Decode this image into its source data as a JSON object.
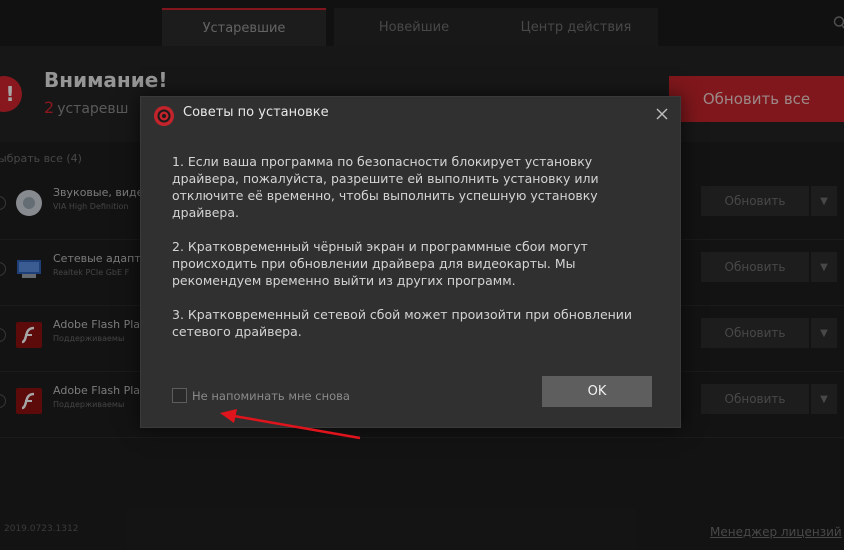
{
  "tabs": [
    {
      "label": "Устаревшие",
      "active": true
    },
    {
      "label": "Новейшие",
      "active": false
    },
    {
      "label": "Центр действия",
      "active": false
    }
  ],
  "alert": {
    "icon": "!",
    "title": "Внимание!",
    "count": "2",
    "subtitle_visible": "устаревш"
  },
  "update_all_label": "Обновить все",
  "select_all_label": "ыбрать все (4)",
  "drivers": [
    {
      "name": "Звуковые, виде",
      "desc": "VIA High Definition",
      "icon": "audio-icon",
      "update_label": "Обновить"
    },
    {
      "name": "Сетевые адапт",
      "desc": "Realtek PCIe GbE F",
      "icon": "network-icon",
      "update_label": "Обновить"
    },
    {
      "name": "Adobe Flash Pla",
      "desc": "Поддерживаемы",
      "icon": "flash-icon",
      "update_label": "Обновить"
    },
    {
      "name": "Adobe Flash Pla",
      "desc": "Поддерживаемы",
      "icon": "flash-icon",
      "update_label": "Обновить"
    }
  ],
  "footer": {
    "version": "2019.0723.1312",
    "license_link": "Менеджер лицензий"
  },
  "dialog": {
    "title": "Советы по установке",
    "paragraphs": [
      "1. Если ваша программа по безопасности блокирует установку драйвера, пожалуйста, разрешите ей выполнить установку или отключите её временно, чтобы выполнить успешную установку драйвера.",
      "2. Кратковременный чёрный экран и программные сбои могут происходить при обновлении драйвера для видеокарты. Мы рекомендуем временно выйти из других программ.",
      "3. Кратковременный сетевой сбой может произойти при обновлении сетевого драйвера."
    ],
    "checkbox_label": "Не напоминать мне снова",
    "checkbox_checked": false,
    "ok_label": "OK"
  },
  "colors": {
    "accent_red": "#c3242b",
    "annotation_arrow": "#e0141c"
  }
}
